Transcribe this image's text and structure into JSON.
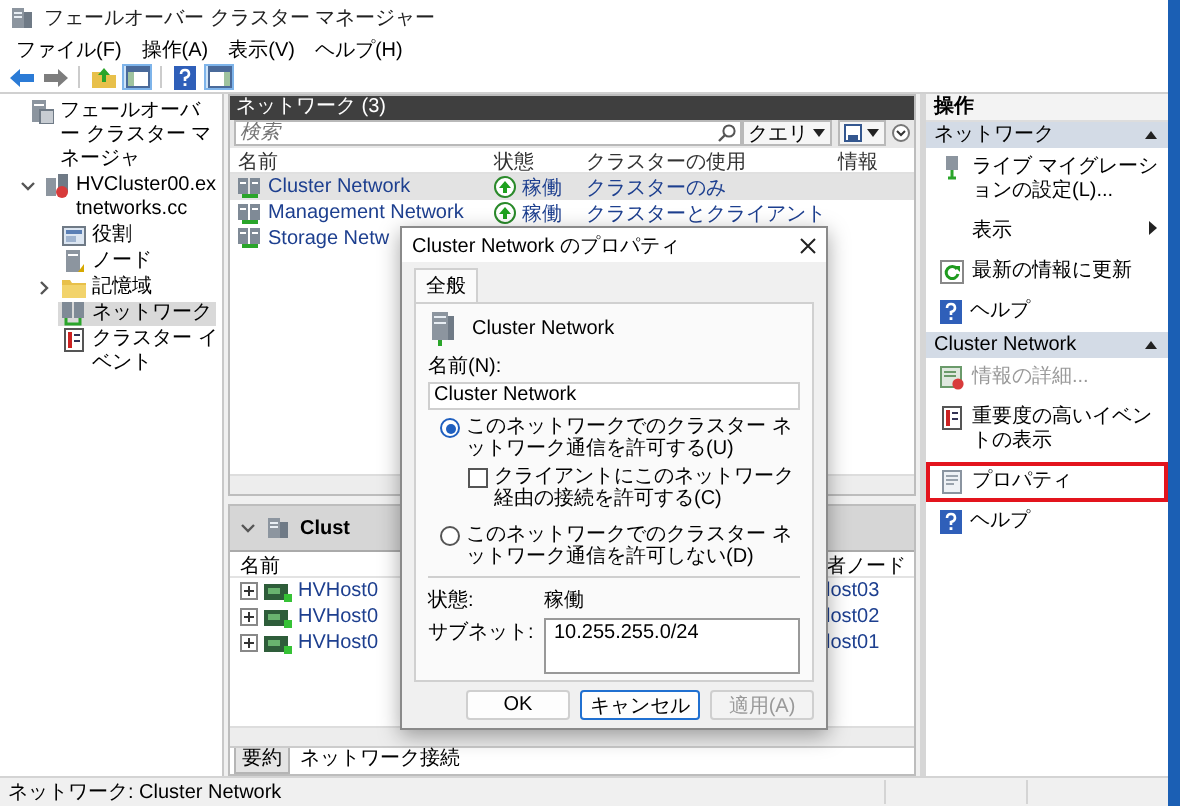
{
  "window": {
    "title": "フェールオーバー クラスター マネージャー"
  },
  "menu": [
    "ファイル(F)",
    "操作(A)",
    "表示(V)",
    "ヘルプ(H)"
  ],
  "toolbar": [
    {
      "kind": "back",
      "pressed": false
    },
    {
      "kind": "forward",
      "pressed": false
    },
    {
      "kind": "up",
      "pressed": false
    },
    {
      "kind": "tree-pane",
      "pressed": true
    },
    {
      "kind": "help",
      "pressed": false
    },
    {
      "kind": "action-pane",
      "pressed": true
    }
  ],
  "tree": {
    "items": [
      {
        "label": "フェールオーバー クラスター マネージャ",
        "kind": "manager",
        "selected": false,
        "children": [
          {
            "label": "HVCluster00.extnetworks.cc",
            "kind": "cluster",
            "selected": false,
            "expanded": true,
            "children": [
              {
                "label": "役割",
                "kind": "roles",
                "selected": false
              },
              {
                "label": "ノード",
                "kind": "nodes",
                "selected": false
              },
              {
                "label": "記憶域",
                "kind": "storage",
                "selected": false,
                "expanded": false
              },
              {
                "label": "ネットワーク",
                "kind": "network",
                "selected": true
              },
              {
                "label": "クラスター イベント",
                "kind": "events",
                "selected": false
              }
            ]
          }
        ]
      }
    ]
  },
  "networks": {
    "title": "ネットワーク (3)",
    "search": {
      "placeholder": "検索"
    },
    "query_button": "クエリ",
    "columns": [
      "名前",
      "状態",
      "クラスターの使用",
      "情報"
    ],
    "rows": [
      {
        "name": "Cluster Network",
        "status": "稼働",
        "use": "クラスターのみ",
        "selected": true
      },
      {
        "name": "Management Network",
        "status": "稼働",
        "use": "クラスターとクライアント",
        "selected": false
      },
      {
        "name": "Storage Netw",
        "selected": false
      }
    ]
  },
  "details": {
    "title": "Clust",
    "columns": [
      "名前",
      "者ノード"
    ],
    "rows": [
      {
        "name": "HVHost0",
        "node": "lost03"
      },
      {
        "name": "HVHost0",
        "node": "lost02"
      },
      {
        "name": "HVHost0",
        "node": "lost01"
      }
    ],
    "tabs": [
      {
        "label": "要約",
        "selected": false
      },
      {
        "label": "ネットワーク接続",
        "selected": true
      }
    ]
  },
  "actions": {
    "title": "操作",
    "sections": [
      {
        "title": "ネットワーク",
        "items": [
          {
            "label": "ライブ マイグレーションの設定(L)...",
            "kind": "migration",
            "disabled": false,
            "highlighted": false
          },
          {
            "label": "表示",
            "kind": "submenu",
            "disabled": false,
            "highlighted": false
          },
          {
            "label": "最新の情報に更新",
            "kind": "refresh",
            "disabled": false,
            "highlighted": false
          },
          {
            "label": "ヘルプ",
            "kind": "help",
            "disabled": false,
            "highlighted": false
          }
        ]
      },
      {
        "title": "Cluster Network",
        "items": [
          {
            "label": "情報の詳細...",
            "kind": "details",
            "disabled": true,
            "highlighted": false
          },
          {
            "label": "重要度の高いイベントの表示",
            "kind": "events",
            "disabled": false,
            "highlighted": false
          },
          {
            "label": "プロパティ",
            "kind": "properties",
            "disabled": false,
            "highlighted": true
          },
          {
            "label": "ヘルプ",
            "kind": "help",
            "disabled": false,
            "highlighted": false
          }
        ]
      }
    ]
  },
  "dialog": {
    "title": "Cluster Network のプロパティ",
    "tabs": [
      {
        "label": "全般",
        "selected": true
      }
    ],
    "header": "Cluster Network",
    "name_label": "名前(N):",
    "name_value": "Cluster Network",
    "options": [
      {
        "kind": "radio",
        "label": "このネットワークでのクラスター ネットワーク通信を許可する(U)",
        "checked": true
      },
      {
        "kind": "checkbox",
        "label": "クライアントにこのネットワーク経由の接続を許可する(C)",
        "checked": false
      },
      {
        "kind": "radio",
        "label": "このネットワークでのクラスター ネットワーク通信を許可しない(D)",
        "checked": false
      }
    ],
    "status_label": "状態:",
    "status_value": "稼働",
    "subnet_label": "サブネット:",
    "subnets": [
      "10.255.255.0/24"
    ],
    "buttons": [
      {
        "label": "OK",
        "disabled": false,
        "focused": false
      },
      {
        "label": "キャンセル",
        "disabled": false,
        "focused": true
      },
      {
        "label": "適用(A)",
        "disabled": true,
        "focused": false
      }
    ]
  },
  "status_bar": "ネットワーク: Cluster Network"
}
